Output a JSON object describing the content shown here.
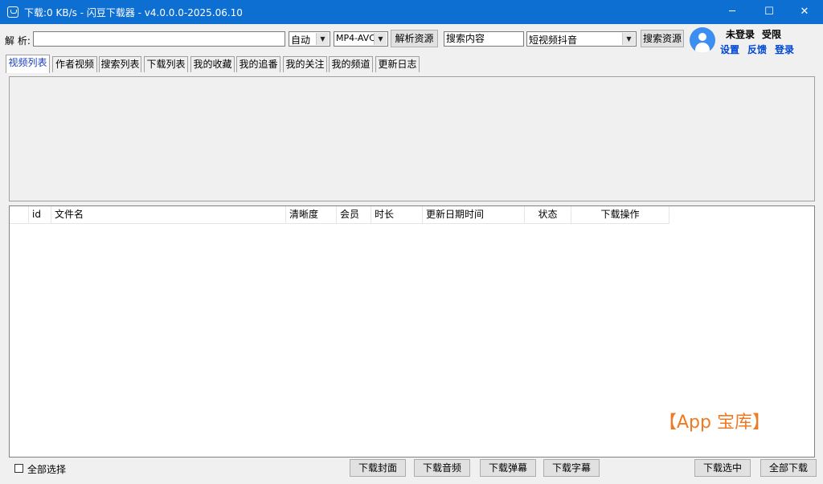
{
  "window": {
    "title": "下载:0 KB/s - 闪豆下载器 - v4.0.0.0-2025.06.10",
    "min": "─",
    "max": "☐",
    "close": "✕"
  },
  "toolbar": {
    "parse_label": "解 析:",
    "parse_input_value": "",
    "quality_select": "自动",
    "format_select": "MP4-AVC",
    "parse_button": "解析资源",
    "search_input_value": "搜索内容",
    "platform_select": "短视频抖音",
    "search_button": "搜索资源"
  },
  "user": {
    "login_status": "未登录",
    "limit": "受限",
    "settings_link": "设置",
    "feedback_link": "反馈",
    "login_link": "登录"
  },
  "tabs": [
    {
      "label": "视频列表"
    },
    {
      "label": "作者视频"
    },
    {
      "label": "搜索列表"
    },
    {
      "label": "下载列表"
    },
    {
      "label": "我的收藏"
    },
    {
      "label": "我的追番"
    },
    {
      "label": "我的关注"
    },
    {
      "label": "我的频道"
    },
    {
      "label": "更新日志"
    }
  ],
  "table": {
    "columns": [
      "id",
      "文件名",
      "清晰度",
      "会员",
      "时长",
      "更新日期时间",
      "状态",
      "下载操作"
    ],
    "rows": []
  },
  "bottom": {
    "select_all": "全部选择",
    "download_cover": "下载封面",
    "download_audio": "下载音频",
    "download_danmaku": "下载弹幕",
    "download_subtitle": "下载字幕",
    "download_selected": "下载选中",
    "download_all": "全部下载"
  },
  "watermark": "【App 宝库】",
  "colors": {
    "titlebar": "#0e6fd2",
    "link": "#0046d5",
    "avatar": "#3c8ef0",
    "active_tab_text": "#1a3cc0",
    "watermark": "#f07a22"
  }
}
